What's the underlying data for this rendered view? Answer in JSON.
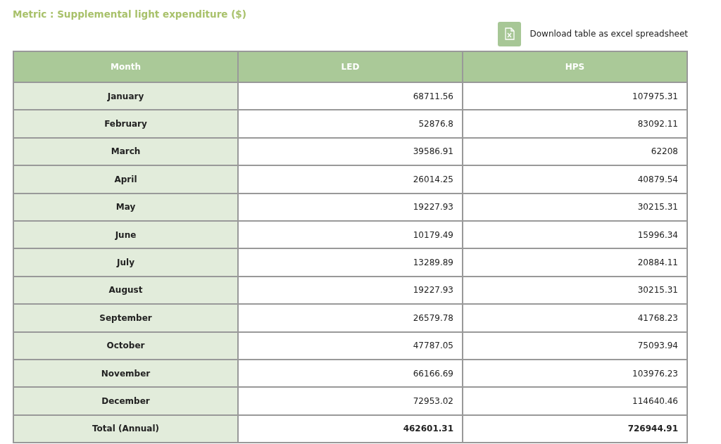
{
  "title": "Metric : Supplemental light expenditure ($)",
  "download": {
    "label": "Download table as excel spreadsheet"
  },
  "table": {
    "columns": [
      "Month",
      "LED",
      "HPS"
    ],
    "rows": [
      {
        "kind": "month",
        "cells": [
          "January",
          "68711.56",
          "107975.31"
        ]
      },
      {
        "kind": "month",
        "cells": [
          "February",
          "52876.8",
          "83092.11"
        ]
      },
      {
        "kind": "month",
        "cells": [
          "March",
          "39586.91",
          "62208"
        ]
      },
      {
        "kind": "month",
        "cells": [
          "April",
          "26014.25",
          "40879.54"
        ]
      },
      {
        "kind": "month",
        "cells": [
          "May",
          "19227.93",
          "30215.31"
        ]
      },
      {
        "kind": "month",
        "cells": [
          "June",
          "10179.49",
          "15996.34"
        ]
      },
      {
        "kind": "month",
        "cells": [
          "July",
          "13289.89",
          "20884.11"
        ]
      },
      {
        "kind": "month",
        "cells": [
          "August",
          "19227.93",
          "30215.31"
        ]
      },
      {
        "kind": "month",
        "cells": [
          "September",
          "26579.78",
          "41768.23"
        ]
      },
      {
        "kind": "month",
        "cells": [
          "October",
          "47787.05",
          "75093.94"
        ]
      },
      {
        "kind": "month",
        "cells": [
          "November",
          "66166.69",
          "103976.23"
        ]
      },
      {
        "kind": "month",
        "cells": [
          "December",
          "72953.02",
          "114640.46"
        ]
      },
      {
        "kind": "total",
        "cells": [
          "Total (Annual)",
          "462601.31",
          "726944.91"
        ]
      }
    ]
  }
}
